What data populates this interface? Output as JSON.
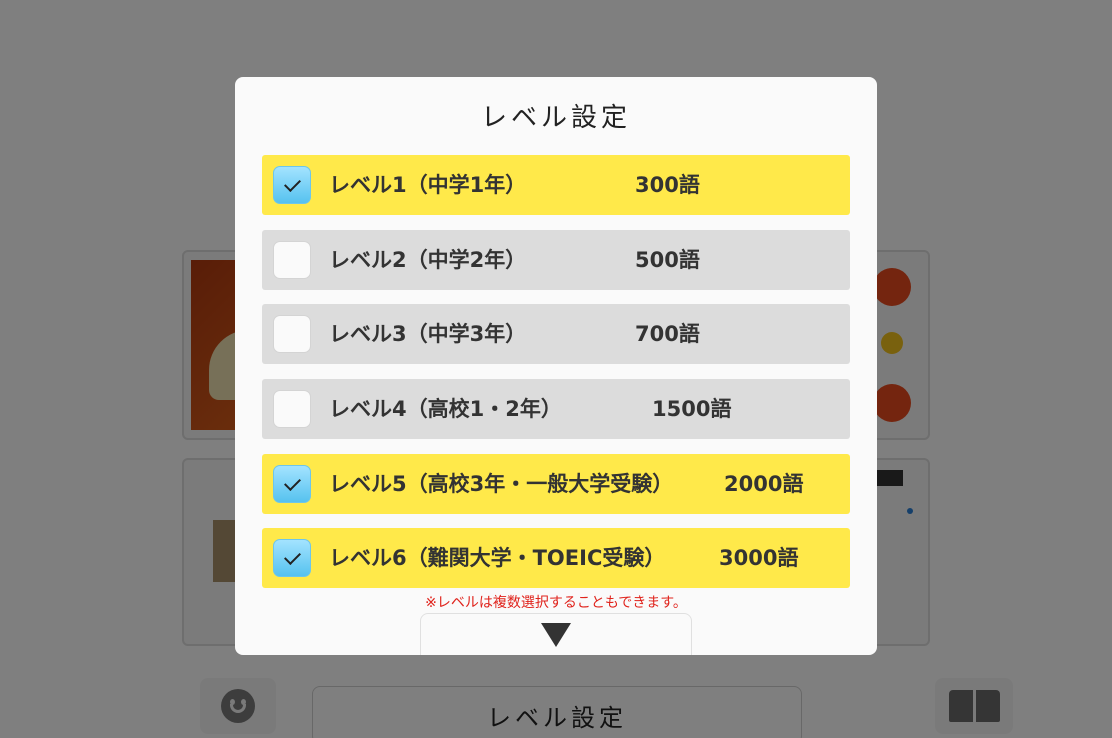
{
  "background": {
    "level_button_label": "レベル設定"
  },
  "modal": {
    "title": "レベル設定",
    "levels": [
      {
        "label": "レベル1（中学1年）",
        "count": "300語",
        "selected": true
      },
      {
        "label": "レベル2（中学2年）",
        "count": "500語",
        "selected": false
      },
      {
        "label": "レベル3（中学3年）",
        "count": "700語",
        "selected": false
      },
      {
        "label": "レベル4（高校1・2年）",
        "count": "1500語",
        "selected": false
      },
      {
        "label": "レベル5（高校3年・一般大学受験）",
        "count": "2000語",
        "selected": true
      },
      {
        "label": "レベル6（難関大学・TOEIC受験）",
        "count": "3000語",
        "selected": true
      }
    ],
    "note": "※レベルは複数選択することもできます。"
  },
  "colors": {
    "selected_row": "#ffe94a",
    "unselected_row": "#dcdcdc",
    "checkbox_checked": "#56c2ef",
    "note_text": "#e0231c"
  },
  "icons": {
    "check": "check-icon",
    "scroll_more": "triangle-down-icon",
    "face": "smiley-icon",
    "book": "book-icon"
  }
}
